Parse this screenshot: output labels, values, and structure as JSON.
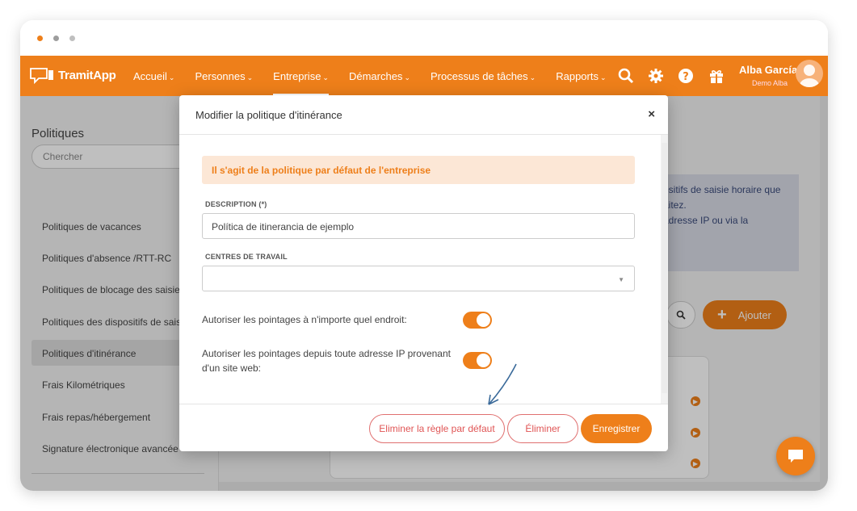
{
  "app": {
    "brand": "TramitApp"
  },
  "nav": {
    "items": [
      {
        "label": "Accueil"
      },
      {
        "label": "Personnes"
      },
      {
        "label": "Entreprise"
      },
      {
        "label": "Démarches"
      },
      {
        "label": "Processus de tâches"
      },
      {
        "label": "Rapports"
      }
    ],
    "caret": "⌄"
  },
  "user": {
    "name": "Alba García",
    "company": "Demo Alba"
  },
  "sidebar": {
    "title": "Politiques",
    "search_placeholder": "Chercher",
    "items": [
      {
        "label": "Politiques de vacances"
      },
      {
        "label": "Politiques d'absence /RTT-RC"
      },
      {
        "label": "Politiques de blocage des saisies"
      },
      {
        "label": "Politiques des dispositifs de saisie"
      },
      {
        "label": "Politiques d'itinérance"
      },
      {
        "label": "Frais Kilométriques"
      },
      {
        "label": "Frais repas/hébergement"
      },
      {
        "label": "Signature électronique avancée"
      }
    ]
  },
  "main": {
    "info_lines": [
      "ositifs de saisie horaire que",
      "aitez.",
      "adresse IP ou via la"
    ],
    "add_label": "Ajouter",
    "add_icon": "+"
  },
  "modal": {
    "title": "Modifier la politique d'itinérance",
    "close": "×",
    "alert": "Il s'agit de la politique par défaut de l'entreprise",
    "description_label": "DESCRIPTION (*)",
    "description_value": "Política de itinerancia de ejemplo",
    "centres_label": "CENTRES DE TRAVAIL",
    "centres_value": "",
    "toggle1_label": "Autoriser les pointages à n'importe quel endroit:",
    "toggle1_on": true,
    "toggle2_label": "Autoriser les pointages depuis toute adresse IP provenant d'un site web:",
    "toggle2_on": true,
    "btn_remove_default": "Eliminer la règle par défaut",
    "btn_delete": "Éliminer",
    "btn_save": "Enregistrer"
  },
  "colors": {
    "accent": "#ee7f1a",
    "info_bg": "#d8dbe6",
    "alert_bg": "#fce7d6",
    "danger": "#e05555"
  },
  "icons": [
    "search-icon",
    "gear-icon",
    "help-icon",
    "gift-icon",
    "chat-icon",
    "close-icon",
    "arrow-right-icon"
  ]
}
